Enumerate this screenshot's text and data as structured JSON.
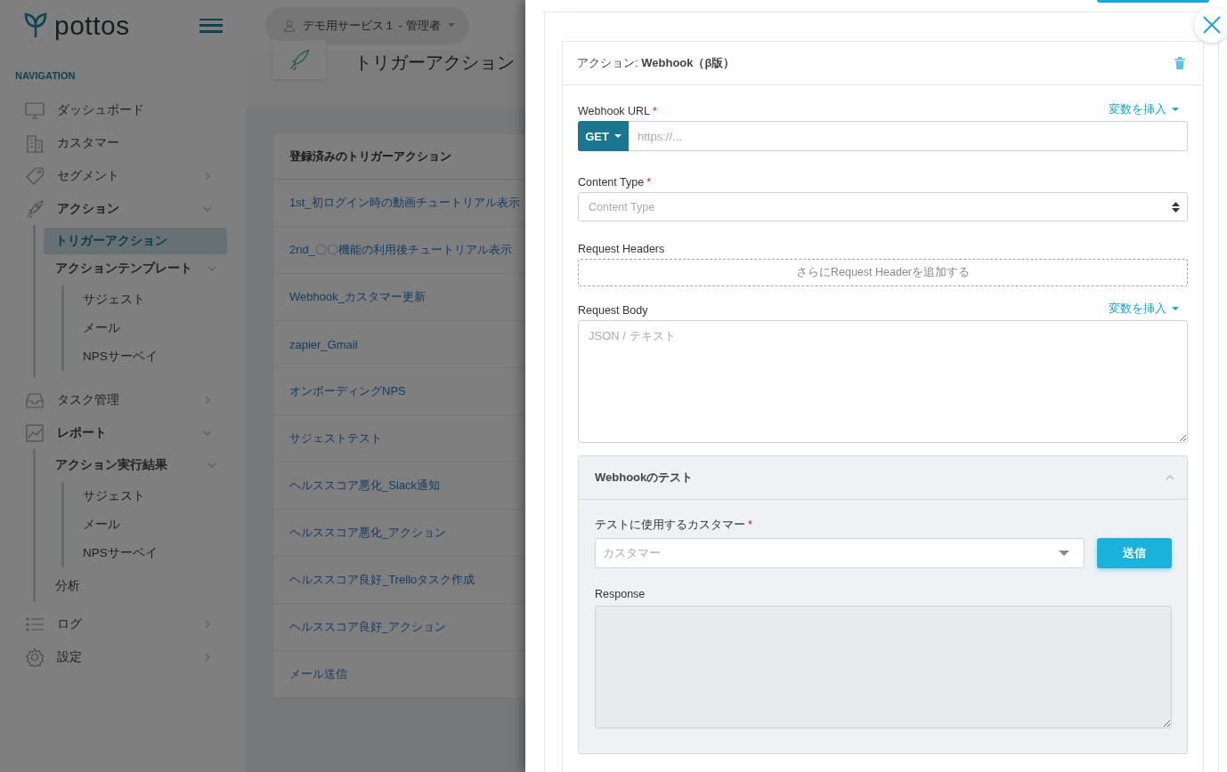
{
  "brand": {
    "name": "pottos"
  },
  "account": {
    "label": "デモ用サービス１ - 管理者"
  },
  "sidebar": {
    "heading": "NAVIGATION",
    "items": [
      {
        "label": "ダッシュボード"
      },
      {
        "label": "カスタマー"
      },
      {
        "label": "セグメント",
        "expanded": false
      },
      {
        "label": "アクション",
        "expanded": true,
        "children": [
          {
            "label": "トリガーアクション",
            "selected": true
          },
          {
            "label": "アクションテンプレート",
            "selected": false,
            "expanded": true,
            "children": [
              {
                "label": "サジェスト"
              },
              {
                "label": "メール"
              },
              {
                "label": "NPSサーベイ"
              }
            ]
          }
        ]
      },
      {
        "label": "タスク管理",
        "expanded": false
      },
      {
        "label": "レポート",
        "expanded": true,
        "children": [
          {
            "label": "アクション実行結果",
            "selected": false,
            "expanded": true,
            "children": [
              {
                "label": "サジェスト"
              },
              {
                "label": "メール"
              },
              {
                "label": "NPSサーベイ"
              }
            ]
          },
          {
            "label": "分析",
            "selected": false
          }
        ]
      },
      {
        "label": "ログ",
        "expanded": false
      },
      {
        "label": "設定",
        "expanded": false
      }
    ]
  },
  "page": {
    "title": "トリガーアクション"
  },
  "trigger_list": {
    "heading": "登録済みのトリガーアクション",
    "rows": [
      "1st_初ログイン時の動画チュートリアル表示",
      "2nd_〇〇機能の利用後チュートリアル表示",
      "Webhook_カスタマー更新",
      "zapier_Gmail",
      "オンボーディングNPS",
      "サジェストテスト",
      "ヘルススコア悪化_Slack通知",
      "ヘルススコア悪化_アクション",
      "ヘルススコア良好_Trelloタスク作成",
      "ヘルススコア良好_アクション",
      "メール送信"
    ]
  },
  "drawer": {
    "card_title": "アクション: **Webhook（β版）**",
    "webhook_url": {
      "label": "Webhook URL",
      "required_mark": "*",
      "insert_variable": "変数を挿入",
      "method": "GET",
      "placeholder": "https://..."
    },
    "content_type": {
      "label": "Content Type",
      "required_mark": "*",
      "placeholder": "Content Type"
    },
    "request_headers": {
      "label": "Request Headers",
      "add_button": "さらにRequest Headerを追加する"
    },
    "request_body": {
      "label": "Request Body",
      "insert_variable": "変数を挿入",
      "placeholder": "JSON / テキスト"
    },
    "test": {
      "title": "Webhookのテスト",
      "expanded": true,
      "customer_label": "テストに使用するカスタマー",
      "required_mark": "*",
      "customer_placeholder": "カスタマー",
      "send_button": "送信",
      "response_label": "Response"
    }
  }
}
